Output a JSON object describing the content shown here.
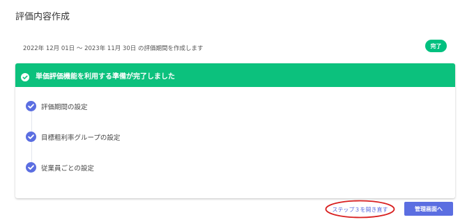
{
  "page": {
    "title": "評価内容作成",
    "period_text": "2022年 12月 01日 〜 2023年 11月 30日 の評価期間を作成します",
    "status_badge": "完了"
  },
  "banner": {
    "icon": "check-circle-icon",
    "text": "単価評価機能を利用する準備が完了しました"
  },
  "steps": [
    {
      "label": "評価期間の設定",
      "icon": "check-circle-icon",
      "status": "completed"
    },
    {
      "label": "目標粗利率グループの設定",
      "icon": "check-circle-icon",
      "status": "completed"
    },
    {
      "label": "従業員ごとの設定",
      "icon": "check-circle-icon",
      "status": "completed"
    }
  ],
  "footer": {
    "reopen_link": "ステップ３を開き直す",
    "manage_button": "管理画面へ"
  },
  "colors": {
    "accent_green": "#0cc17d",
    "accent_blue": "#5b6ee1",
    "annotation_red": "#d81e1e"
  }
}
